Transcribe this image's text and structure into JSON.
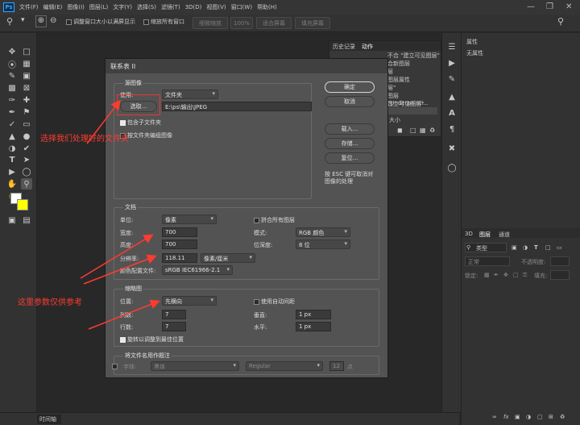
{
  "menubar": {
    "logo": "Ps",
    "items": [
      "文件(F)",
      "编辑(E)",
      "图像(I)",
      "图层(L)",
      "文字(Y)",
      "选择(S)",
      "滤镜(T)",
      "3D(D)",
      "视图(V)",
      "窗口(W)",
      "帮助(H)"
    ]
  },
  "options": {
    "resize_windows": "调整窗口大小以满屏显示",
    "zoom_all": "缩放所有窗口",
    "scrubby": "细微缩放",
    "percent": "100%",
    "fit_screen": "适合屏幕",
    "fill_screen": "填充屏幕"
  },
  "history_panel": {
    "tabs": [
      "历史记录",
      "动作"
    ],
    "lines": [
      "不合 \"建立可见图层\"",
      "合新图层",
      "层",
      "图层属性",
      "层\"",
      "图层 \"Underpainti...",
      "建立可见图层\""
    ],
    "footer": "大小"
  },
  "right_panel": {
    "properties_tab": "属性",
    "no_properties": "无属性",
    "layer_tabs": [
      "3D",
      "图层",
      "通道"
    ],
    "kind": "类型",
    "blend": "正常",
    "opacity_label": "不透明度:",
    "lock_label": "锁定:",
    "fill_label": "填充:"
  },
  "dialog": {
    "title": "联系表 II",
    "source_group": "源图像",
    "use_label": "使用:",
    "use_value": "文件夹",
    "choose_button": "选取...",
    "path_value": "E:\\ps\\输出\\JPEG",
    "include_subfolders": "包含子文件夹",
    "group_by_folder": "按文件夹编组图像",
    "ok": "确定",
    "cancel": "取消",
    "load": "载入...",
    "save": "存储...",
    "reset": "复位...",
    "esc_hint_1": "按 ESC 键可取消对",
    "esc_hint_2": "图像的处理",
    "doc_group": "文档",
    "unit_label": "单位:",
    "unit_value": "像素",
    "flatten": "拼合所有图层",
    "width_label": "宽度:",
    "width_value": "700",
    "height_label": "高度:",
    "height_value": "700",
    "mode_label": "模式:",
    "mode_value": "RGB 颜色",
    "depth_label": "位深度:",
    "depth_value": "8 位",
    "resolution_label": "分辨率:",
    "resolution_value": "118.11",
    "resolution_unit": "像素/厘米",
    "profile_label": "颜色配置文件:",
    "profile_value": "sRGB IEC61966-2.1",
    "thumb_group": "缩略图",
    "place_label": "位置:",
    "place_value": "先横向",
    "auto_spacing": "使用自动间距",
    "cols_label": "列数:",
    "cols_value": "7",
    "rows_label": "行数:",
    "rows_value": "7",
    "vert_label": "垂直:",
    "vert_value": "1 px",
    "horiz_label": "水平:",
    "horiz_value": "1 px",
    "rotate": "旋转以调整到最佳位置",
    "caption_group": "将文件名用作题注",
    "font_label": "字体:",
    "font_value": "黑体",
    "font_style": "Regular",
    "font_size": "12",
    "font_unit": "点"
  },
  "annotations": {
    "note1": "选择我们处理好的文件夹",
    "note2": "这里参数仅供参考"
  },
  "status": {
    "timeline": "时间轴"
  },
  "colors": {
    "annotation": "#ff3b30",
    "foreground": "#ffffff",
    "background": "#ffff00"
  }
}
